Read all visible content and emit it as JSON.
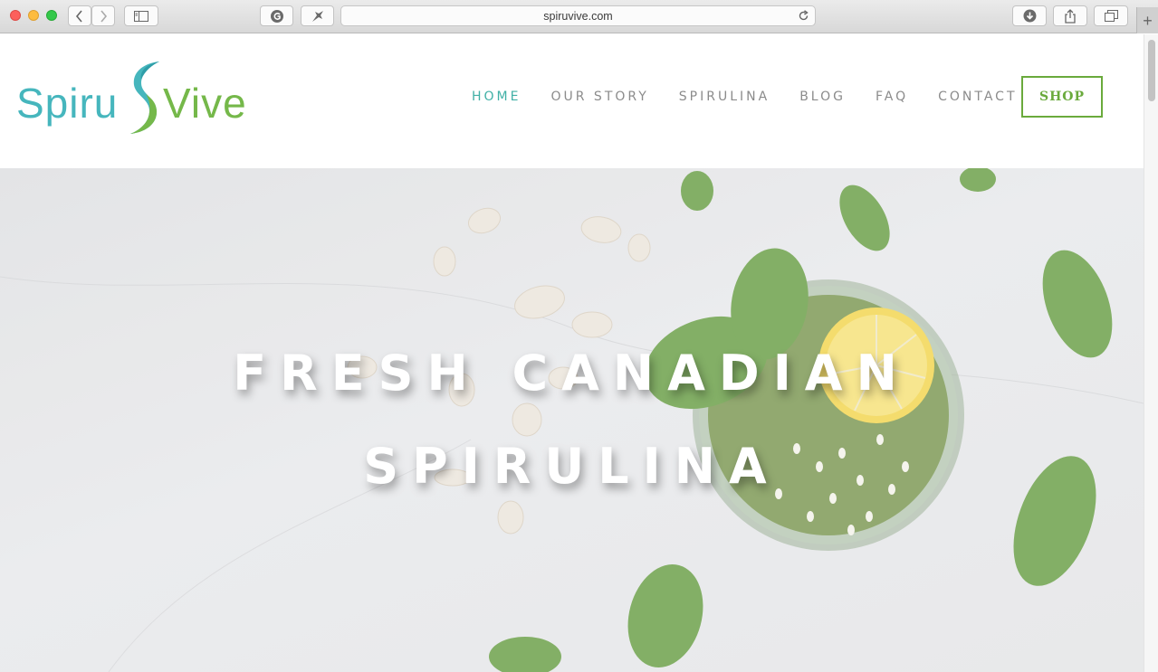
{
  "browser": {
    "url": "spiruvive.com",
    "icons": [
      "back-icon",
      "forward-icon",
      "sidebar-icon",
      "grammarly-icon",
      "extension-icon",
      "reload-icon",
      "download-icon",
      "share-icon",
      "tabs-icon",
      "new-tab-icon"
    ]
  },
  "logo": {
    "left_text": "Spiru",
    "right_text": "Vive",
    "colors": {
      "teal": "#46b6bd",
      "green": "#75b84a"
    }
  },
  "nav": {
    "items": [
      {
        "label": "HOME",
        "active": true
      },
      {
        "label": "OUR STORY",
        "active": false
      },
      {
        "label": "SPIRULINA",
        "active": false
      },
      {
        "label": "BLOG",
        "active": false
      },
      {
        "label": "FAQ",
        "active": false
      },
      {
        "label": "CONTACT",
        "active": false
      }
    ],
    "shop_label": "SHOP",
    "colors": {
      "active": "#40b0a6",
      "inactive": "#8b8b8b",
      "shop": "#6aaa3c"
    }
  },
  "hero": {
    "line1": "FRESH CANADIAN",
    "line2": "SPIRULINA"
  }
}
